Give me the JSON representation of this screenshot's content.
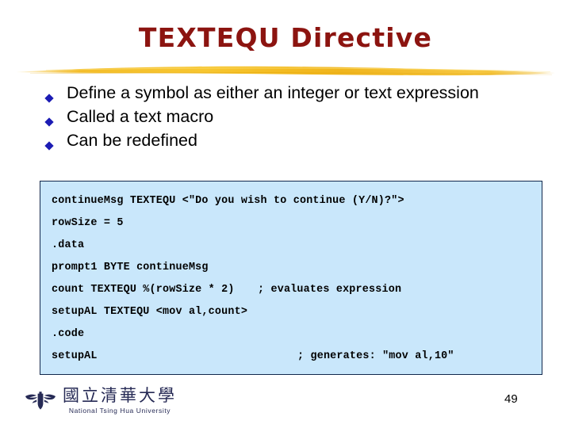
{
  "slide": {
    "title": "TEXTEQU Directive",
    "page_number": "49",
    "title_color": "#8c1410",
    "accent_color": "#f5b91e",
    "bullet_color": "#1c1cb4",
    "code_background": "#c9e7fb",
    "code_border": "#12284c"
  },
  "bullets": [
    {
      "text": "Define a symbol as either an integer or text expression"
    },
    {
      "text": "Called a text macro"
    },
    {
      "text": "Can be redefined"
    }
  ],
  "code": {
    "lines": [
      {
        "text": "continueMsg TEXTEQU <\"Do you wish to continue (Y/N)?\">",
        "comment": ""
      },
      {
        "text": "rowSize = 5",
        "comment": ""
      },
      {
        "text": ".data",
        "comment": ""
      },
      {
        "text": "prompt1 BYTE continueMsg",
        "comment": ""
      },
      {
        "text": "count TEXTEQU %(rowSize * 2)",
        "comment": "; evaluates expression"
      },
      {
        "text": "setupAL TEXTEQU <mov al,count>",
        "comment": ""
      },
      {
        "text": ".code",
        "comment": ""
      },
      {
        "text": "setupAL",
        "comment": "; generates: \"mov al,10\""
      }
    ]
  },
  "footer": {
    "logo_cn": "國立清華大學",
    "logo_en": "National Tsing Hua University"
  }
}
